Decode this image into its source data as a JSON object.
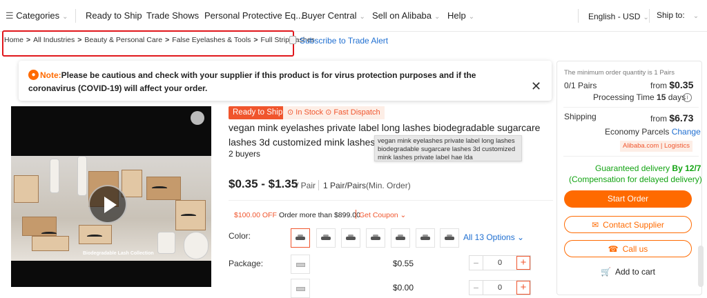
{
  "nav": {
    "categories": "Categories",
    "items": [
      "Ready to Ship",
      "Trade Shows",
      "Personal Protective Eq...",
      "Buyer Central",
      "Sell on Alibaba",
      "Help"
    ],
    "language": "English - USD",
    "ship_to": "Ship to:"
  },
  "breadcrumb": [
    "Home",
    "All Industries",
    "Beauty & Personal Care",
    "False Eyelashes & Tools",
    "Full Strip Lashes"
  ],
  "subscribe": "Subscribe to Trade Alert",
  "notice": {
    "label": "Note:",
    "text": "Please be cautious and check with your supplier if this product is for virus protection purposes and if the coronavirus (COVID-19) will affect your order."
  },
  "video": {
    "caption": "Biodegradable Lash Collection"
  },
  "product": {
    "ready_badge": "Ready to Ship",
    "stock_badge": "⊙ In Stock ⊙ Fast Dispatch",
    "title_line1": "vegan mink eyelashes private label long lashes biodegradable sugarcare",
    "title_line2": "lashes 3d customized mink lashes private label hae lda",
    "buyers": "2 buyers",
    "tooltip": "vegan mink eyelashes private label long lashes biodegradable sugarcare lashes 3d customized mink lashes private label hae lda",
    "price": "$0.35 - $1.35",
    "price_unit": "/ Pair",
    "moq_value": "1 Pair/Pairs",
    "moq_suffix": "(Min. Order)",
    "coupon_off": "$100.00 OFF",
    "coupon_order": "Order more than $899.00",
    "coupon_get": "Get Coupon ⌄",
    "color_label": "Color:",
    "color_more": "All 13 Options ⌄",
    "package_label": "Package:",
    "package_price": "$0.55",
    "package_qty": "0",
    "package_price2": "$0.00",
    "package_qty2": "0"
  },
  "panel": {
    "moq_note": "The minimum order quantity is 1 Pairs",
    "pairs": "0/1 Pairs",
    "from_label": "from",
    "from_price": "$0.35",
    "processing": "Processing Time",
    "processing_days": "15",
    "processing_unit": "days",
    "shipping": "Shipping",
    "ship_price": "$6.73",
    "economy": "Economy Parcels",
    "change": "Change",
    "logistics": "Alibaba.com | Logistics",
    "guarantee1": "Guaranteed delivery",
    "guarantee_date": "By 12/7",
    "guarantee2": "(Compensation for delayed delivery)",
    "start_order": "Start Order",
    "contact": "Contact Supplier",
    "call": "Call us",
    "cart": "Add to cart"
  },
  "colors": {
    "accent": "#ff6a00",
    "badge_red": "#f0552d",
    "link": "#1f6fd1",
    "green": "#12a312",
    "highlight": "#e0161b"
  },
  "icons": [
    "list-icon",
    "chevron-down-icon",
    "file-icon",
    "bulb-icon",
    "close-icon",
    "play-icon",
    "mail-icon",
    "phone-icon",
    "cart-icon",
    "info-icon"
  ]
}
